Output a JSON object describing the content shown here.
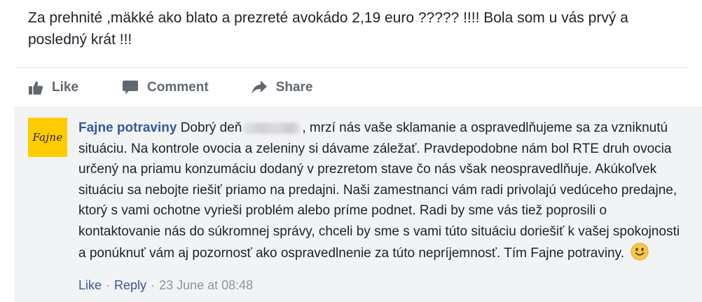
{
  "post": {
    "text": "Za prehnité ,mäkké ako blato a prezreté avokádo 2,19 euro ????? !!!! Bola som u vás prvý a posledný krát !!!"
  },
  "actions": {
    "like_label": "Like",
    "comment_label": "Comment",
    "share_label": "Share"
  },
  "comment": {
    "avatar_text": "Fajne",
    "author": "Fajne potraviny",
    "text_before_name": "Dobrý deň",
    "text_after_name": ", mrzí nás vaše sklamanie a ospravedlňujeme sa za vzniknutú situáciu. Na kontrole ovocia a zeleniny si dávame záležať. Pravdepodobne nám bol RTE druh ovocia určený na priamu konzumáciu dodaný v prezretom stave čo nás však neospravedlňuje. Akúkoľvek situáciu sa nebojte riešiť priamo na predajni. Naši zamestnanci vám radi privolajú vedúceho predajne, ktorý s vami ochotne vyrieši problém alebo príme podnet. Radi by sme vás tiež poprosili o kontaktovanie nás do súkromnej správy, chceli by sme s vami túto situáciu doriešiť k vašej spokojnosti a ponúknuť vám aj pozornosť ako ospravedlnenie za túto nepríjemnosť. Tím Fajne potraviny.",
    "meta": {
      "like_label": "Like",
      "separator": "·",
      "reply_label": "Reply",
      "timestamp": "23 June at 08:48"
    }
  },
  "colors": {
    "link_blue": "#385898",
    "action_gray": "#606770",
    "meta_gray": "#90949c",
    "avatar_yellow": "#ffcc00",
    "comment_bg": "#f2f3f5"
  },
  "icons": {
    "like": "thumbs-up-icon",
    "comment": "speech-bubble-icon",
    "share": "share-arrow-icon",
    "emoji": "smiley-emoji-icon"
  }
}
